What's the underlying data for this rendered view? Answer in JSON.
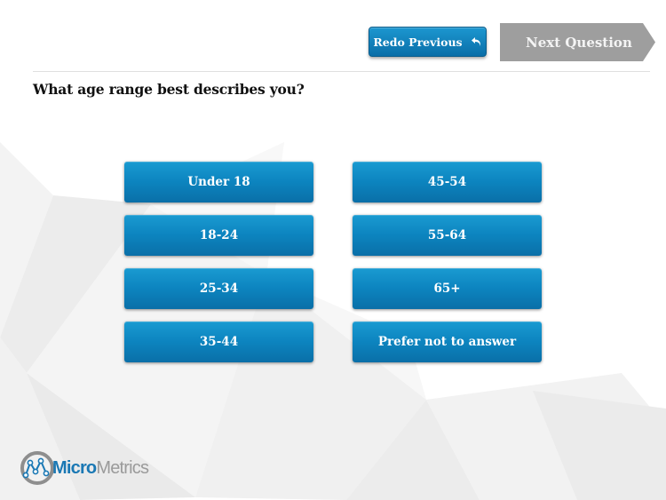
{
  "header": {
    "redo_label": "Redo Previous",
    "redo_icon": "undo-arrow-icon",
    "next_label": "Next Question"
  },
  "question": {
    "text": "What age range best describes you?"
  },
  "options": [
    {
      "label": "Under 18"
    },
    {
      "label": "45-54"
    },
    {
      "label": "18-24"
    },
    {
      "label": "55-64"
    },
    {
      "label": "25-34"
    },
    {
      "label": "65+"
    },
    {
      "label": "35-44"
    },
    {
      "label": "Prefer not to answer"
    }
  ],
  "logo": {
    "part1": "Micro",
    "part2": "Metrics"
  },
  "colors": {
    "primary_blue": "#0c84bf",
    "next_gray": "#9e9e9e",
    "logo_blue": "#1a78b4",
    "logo_gray": "#9a9a9a"
  }
}
